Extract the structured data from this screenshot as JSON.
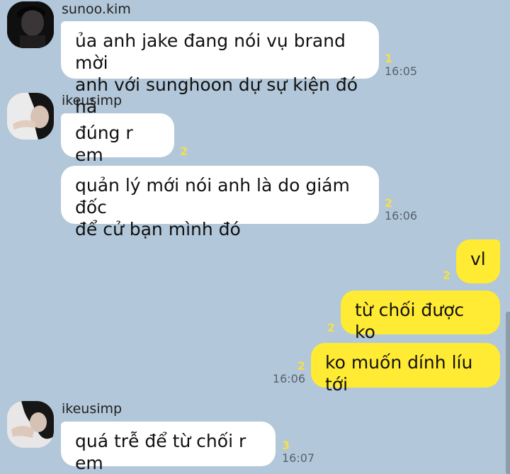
{
  "messages": [
    {
      "sender": "sunoo.kim",
      "text": "ủa anh jake đang nói vụ brand mời\nanh với sunghoon dự sự kiện đó hả",
      "unread": "1",
      "time": "16:05"
    },
    {
      "sender": "ikeusimp",
      "text": "đúng r em",
      "unread": "2",
      "time": ""
    },
    {
      "text": "quản lý mới nói anh là do giám đốc\nđể cử bạn mình đó",
      "unread": "2",
      "time": "16:06"
    },
    {
      "text": "vl",
      "unread": "2",
      "time": ""
    },
    {
      "text": "từ chối được ko",
      "unread": "2",
      "time": ""
    },
    {
      "text": "ko muốn dính líu tới",
      "unread": "2",
      "time": "16:06"
    },
    {
      "sender": "ikeusimp",
      "text": "quá trễ để từ chối r em",
      "unread": "3",
      "time": "16:07"
    }
  ],
  "colors": {
    "background": "#b2c7d9",
    "incoming": "#ffffff",
    "outgoing": "#ffeb33",
    "unread": "#f4e04a"
  }
}
